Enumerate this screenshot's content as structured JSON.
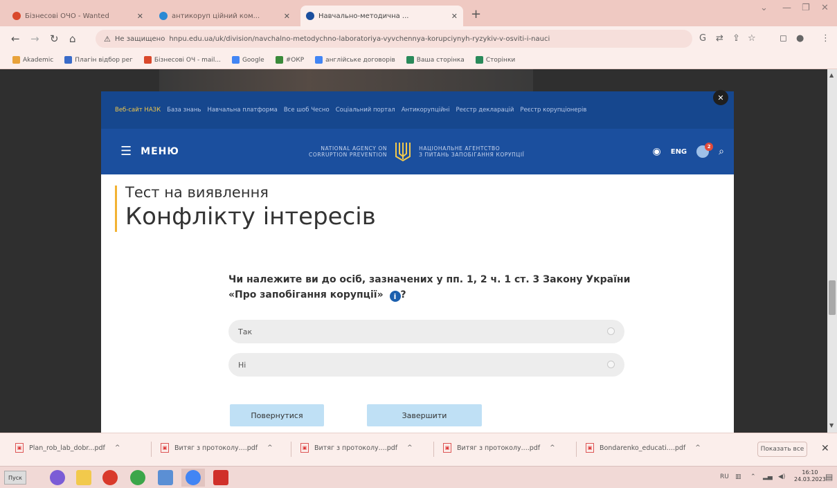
{
  "browser": {
    "tabs": [
      {
        "title": "Бізнесові ОЧО - Wanted",
        "active": false,
        "favicon_color": "#d9482b"
      },
      {
        "title": "антикоруп ційний ком...",
        "active": false,
        "favicon_color": "#2a8ad4"
      },
      {
        "title": "Навчально-методична ...",
        "active": true,
        "favicon_color": "#1b4f9e"
      }
    ],
    "new_tab": "+",
    "window_controls": [
      "⌄",
      "—",
      "❐",
      "✕"
    ],
    "url_warning": "Не защищено",
    "url": "hnpu.edu.ua/uk/division/navchalno-metodychno-laboratoriya-vyvchennya-korupciynyh-ryzykiv-v-osviti-i-nauci",
    "bookmarks": [
      {
        "label": "Akademic",
        "color": "#e8a23a"
      },
      {
        "label": "Плагін відбор рег",
        "color": "#3a6bc8"
      },
      {
        "label": "Бізнесові ОЧ - mail...",
        "color": "#d9482b"
      },
      {
        "label": "Google",
        "color": "#4285f4"
      },
      {
        "label": "#ОКР",
        "color": "#3a8a3a"
      },
      {
        "label": "англійське договорів",
        "color": "#4285f4"
      },
      {
        "label": "Ваша сторінка",
        "color": "#2a8a5a"
      },
      {
        "label": "Сторінки",
        "color": "#2a8a5a"
      }
    ]
  },
  "site": {
    "quicklinks": [
      "Веб-сайт НАЗК",
      "База знань",
      "Навчальна платформа",
      "Все шоб Чесно",
      "Соціальний портал",
      "Антикорупційні",
      "Реєстр декларацій",
      "Реєстр корупціонерів"
    ],
    "menu_label": "МЕНЮ",
    "logo_en_1": "NATIONAL AGENCY ON",
    "logo_en_2": "CORRUPTION PREVENTION",
    "logo_ua_1": "НАЦІОНАЛЬНЕ АГЕНТСТВО",
    "logo_ua_2": "З ПИТАНЬ ЗАПОБІГАННЯ КОРУПЦІЇ",
    "lang": "ENG",
    "badge_count": "2"
  },
  "test": {
    "title_small": "Тест на виявлення",
    "title_large": "Конфлікту інтересів",
    "question": "Чи належите ви до осіб, зазначених у пп. 1, 2 ч. 1 ст. 3 Закону України «Про запобігання корупції»",
    "question_end": "?",
    "info": "i",
    "options": [
      {
        "label": "Так"
      },
      {
        "label": "Ні"
      }
    ],
    "back_label": "Повернутися",
    "finish_label": "Завершити"
  },
  "downloads": {
    "items": [
      {
        "name": "Plan_rob_lab_dobr...pdf"
      },
      {
        "name": "Витяг з протоколу....pdf"
      },
      {
        "name": "Витяг з протоколу....pdf"
      },
      {
        "name": "Витяг з протоколу....pdf"
      },
      {
        "name": "Bondarenko_educati....pdf"
      }
    ],
    "show_all": "Показать все",
    "close": "✕"
  },
  "taskbar": {
    "start_label": "Пуск",
    "apps": [
      {
        "color": "#7b5cd6",
        "active": false
      },
      {
        "color": "#f2c94c",
        "active": false
      },
      {
        "color": "#d93a2b",
        "active": false
      },
      {
        "color": "#3ca64a",
        "active": false
      },
      {
        "color": "#5b8fd4",
        "active": false
      },
      {
        "color": "#4285f4",
        "active": true
      },
      {
        "color": "#d0302a",
        "active": false
      }
    ],
    "tray": "RU",
    "time": "16:10",
    "date": "24.03.2023"
  }
}
